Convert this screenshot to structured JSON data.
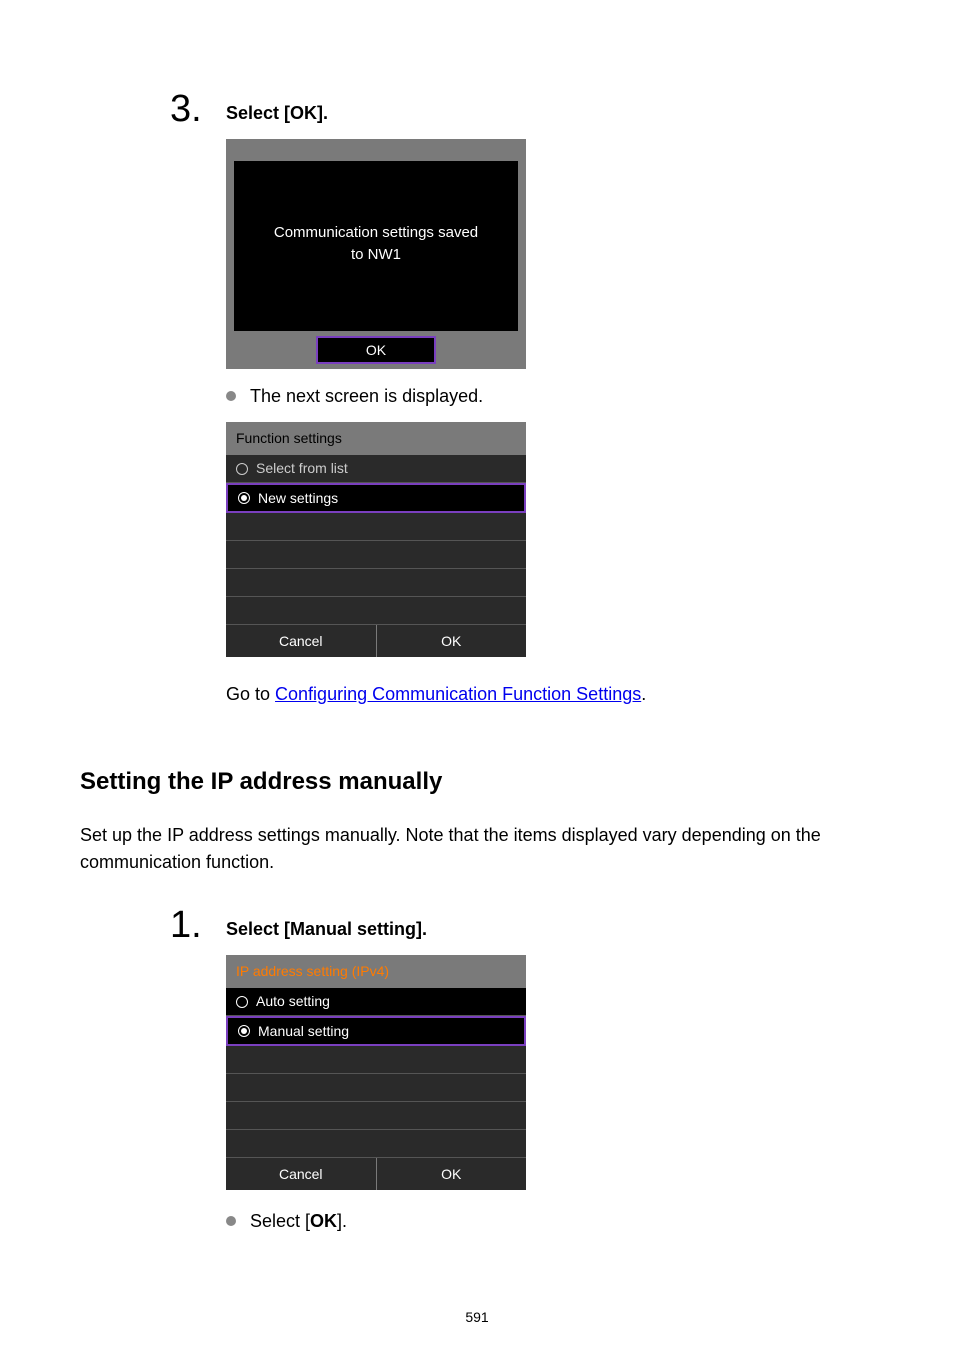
{
  "step3": {
    "number": "3.",
    "title": "Select [OK].",
    "dialog_line1": "Communication settings saved",
    "dialog_line2": "to NW1",
    "dialog_ok": "OK",
    "bullet_text": "The next screen is displayed.",
    "list_header": "Function settings",
    "list_option1": "Select from list",
    "list_option2": "New settings",
    "list_cancel": "Cancel",
    "list_ok": "OK",
    "goto_prefix": "Go to ",
    "goto_link": "Configuring Communication Function Settings",
    "goto_suffix": "."
  },
  "section": {
    "heading": "Setting the IP address manually",
    "paragraph": "Set up the IP address settings manually. Note that the items displayed vary depending on the communication function."
  },
  "step1": {
    "number": "1.",
    "title": "Select [Manual setting].",
    "list_header": "IP address setting (IPv4)",
    "list_option1": "Auto setting",
    "list_option2": "Manual setting",
    "list_cancel": "Cancel",
    "list_ok": "OK",
    "bullet_prefix": "Select [",
    "bullet_bold": "OK",
    "bullet_suffix": "]."
  },
  "page_number": "591"
}
